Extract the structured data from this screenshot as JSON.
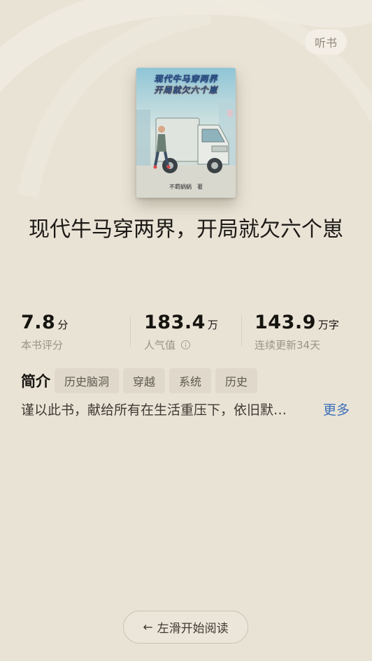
{
  "header": {
    "listen_label": "听书"
  },
  "cover": {
    "title_line1": "现代牛马穿两界",
    "title_line2": "开局就欠六个崽",
    "author": "不羁蜗蜗　著"
  },
  "book": {
    "title": "现代牛马穿两界，开局就欠六个崽"
  },
  "stats": {
    "rating": {
      "value": "7.8",
      "unit": "分",
      "label": "本书评分"
    },
    "popularity": {
      "value": "183.4",
      "unit": "万",
      "label": "人气值",
      "icon": "info-icon"
    },
    "words": {
      "value": "143.9",
      "unit": "万字",
      "label": "连续更新34天"
    }
  },
  "intro": {
    "label": "简介",
    "tags": [
      "历史脑洞",
      "穿越",
      "系统",
      "历史"
    ],
    "synopsis": "谨以此书，献给所有在生活重压下，依旧默…",
    "more_label": "更多"
  },
  "footer": {
    "read_label": "左滑开始阅读",
    "icon": "arrow-left-icon"
  },
  "colors": {
    "background": "#e9e3d6",
    "link": "#3d6fb8",
    "tag_bg": "#e0d9cb"
  }
}
